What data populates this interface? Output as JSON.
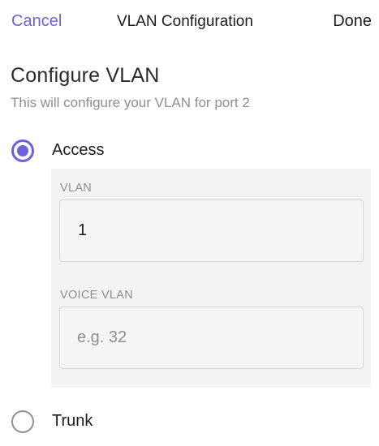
{
  "nav": {
    "cancel_label": "Cancel",
    "title": "VLAN Configuration",
    "done_label": "Done"
  },
  "header": {
    "title": "Configure VLAN",
    "subtitle": "This will configure your VLAN for port 2"
  },
  "options": [
    {
      "label": "Access",
      "selected": true
    },
    {
      "label": "Trunk",
      "selected": false
    }
  ],
  "access_panel": {
    "vlan": {
      "label": "VLAN",
      "value": "1"
    },
    "voice_vlan": {
      "label": "VOICE VLAN",
      "value": "",
      "placeholder": "e.g. 32"
    }
  },
  "colors": {
    "accent": "#6c63d9",
    "muted_text": "#8e8e93",
    "panel_bg": "#f3f3f3"
  }
}
